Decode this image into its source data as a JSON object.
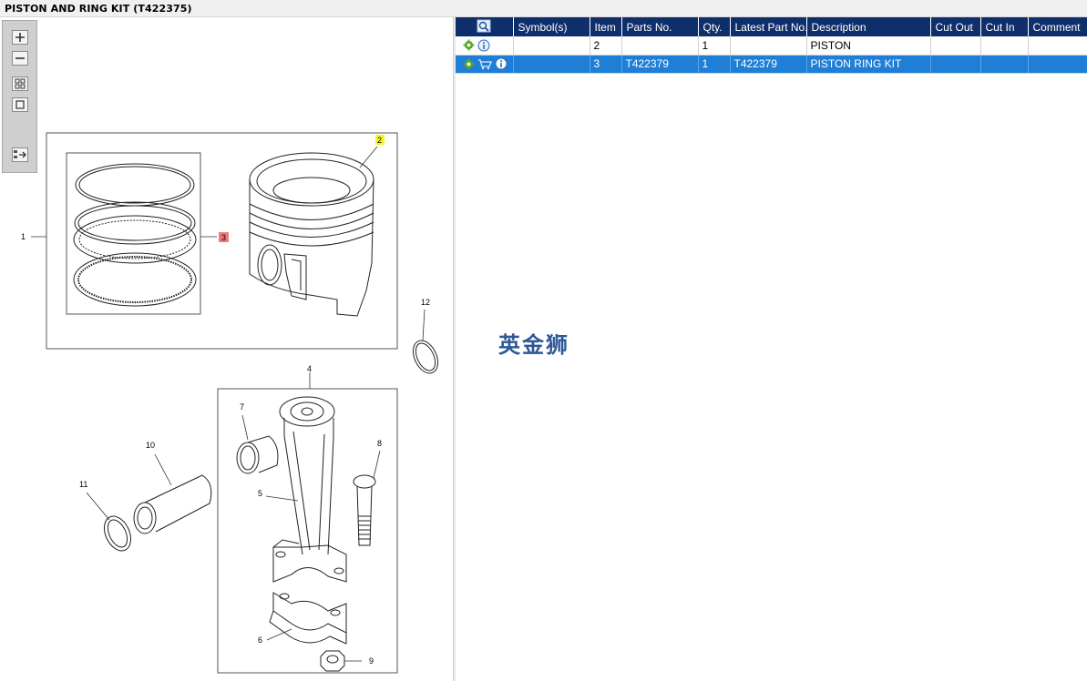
{
  "title": "PISTON AND RING KIT (T422375)",
  "toolbar": {
    "zoom_in": "zoom-in-icon",
    "zoom_out": "zoom-out-icon",
    "fit_all": "fit-all-icon",
    "fit_page": "fit-page-icon",
    "list_view": "list-view-icon"
  },
  "diagram": {
    "callouts": [
      "1",
      "2",
      "3",
      "4",
      "5",
      "6",
      "7",
      "8",
      "9",
      "10",
      "11",
      "12"
    ],
    "highlight_colors": {
      "item_2": "#f5f52a",
      "item_3": "#f07a7a"
    }
  },
  "table": {
    "headers": {
      "search": "search-icon",
      "symbols": "Symbol(s)",
      "item": "Item",
      "part_no": "Parts No.",
      "qty": "Qty.",
      "latest_part_no": "Latest Part No.",
      "description": "Description",
      "cut_out": "Cut Out",
      "cut_in": "Cut In",
      "comment": "Comment"
    },
    "rows": [
      {
        "item": "2",
        "part_no": "",
        "qty": "1",
        "latest_part_no": "",
        "description": "PISTON",
        "cut_out": "",
        "cut_in": "",
        "comment": ""
      },
      {
        "item": "3",
        "part_no": "T422379",
        "qty": "1",
        "latest_part_no": "T422379",
        "description": "PISTON RING KIT",
        "cut_out": "",
        "cut_in": "",
        "comment": ""
      }
    ]
  },
  "watermark": "英金狮",
  "colors": {
    "header_bg": "#0e2f6b",
    "selected_row": "#1f7fd6"
  }
}
